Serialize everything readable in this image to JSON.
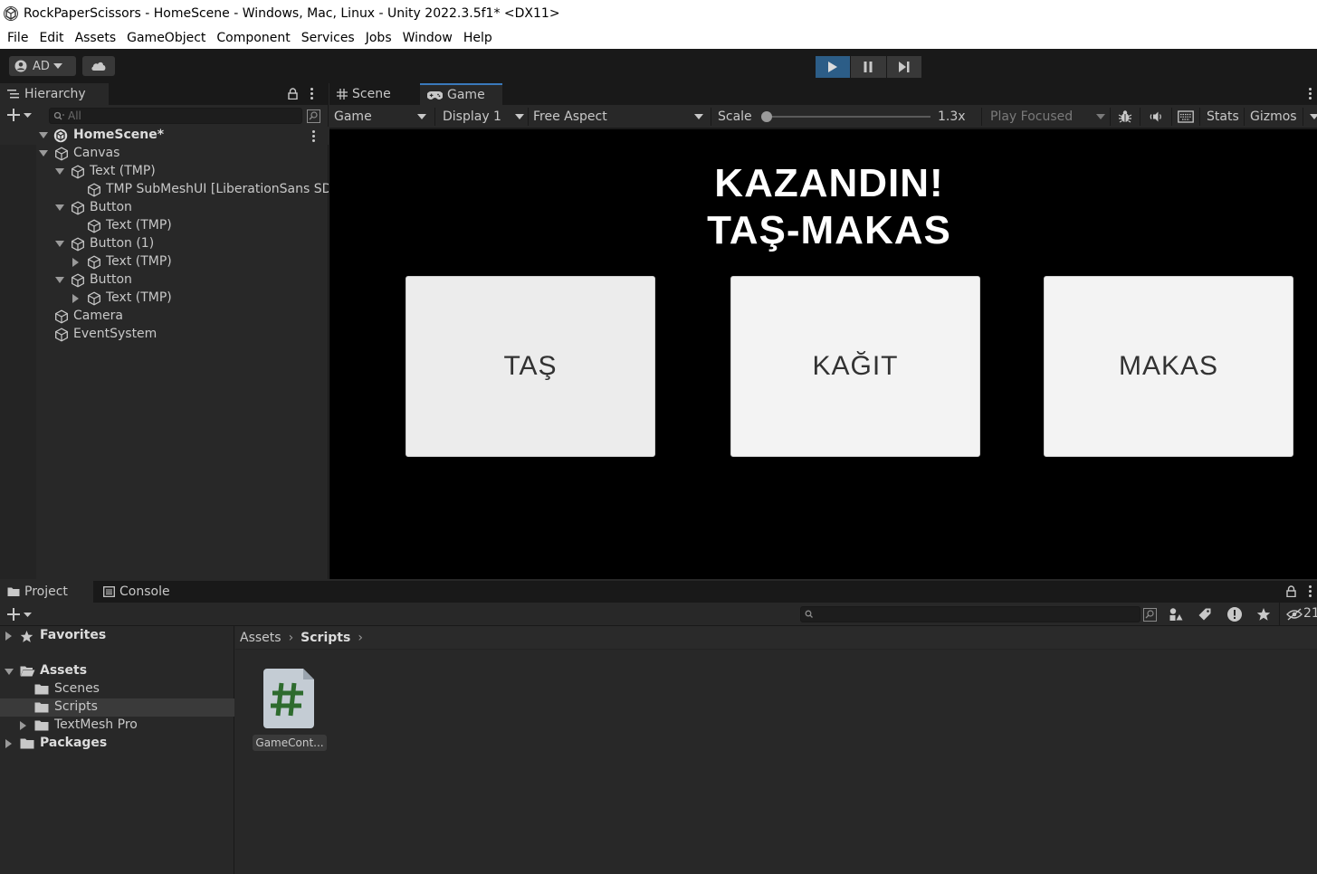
{
  "window": {
    "title": "RockPaperScissors - HomeScene - Windows, Mac, Linux - Unity 2022.3.5f1* <DX11>"
  },
  "menu": [
    "File",
    "Edit",
    "Assets",
    "GameObject",
    "Component",
    "Services",
    "Jobs",
    "Window",
    "Help"
  ],
  "toolbar": {
    "account_label": "AD"
  },
  "hierarchy": {
    "tab_label": "Hierarchy",
    "search_placeholder": "All",
    "scene_name": "HomeScene*",
    "items": [
      {
        "label": "Canvas",
        "depth": 1,
        "expander": "down"
      },
      {
        "label": "Text (TMP)",
        "depth": 2,
        "expander": "down"
      },
      {
        "label": "TMP SubMeshUI [LiberationSans SDF Material + LiberationSans SDF - Fallback Atlas]",
        "depth": 3,
        "expander": "none"
      },
      {
        "label": "Button",
        "depth": 2,
        "expander": "down"
      },
      {
        "label": "Text (TMP)",
        "depth": 3,
        "expander": "none"
      },
      {
        "label": "Button (1)",
        "depth": 2,
        "expander": "down"
      },
      {
        "label": "Text (TMP)",
        "depth": 3,
        "expander": "right"
      },
      {
        "label": "Button",
        "depth": 2,
        "expander": "down"
      },
      {
        "label": "Text (TMP)",
        "depth": 3,
        "expander": "right"
      },
      {
        "label": "Camera",
        "depth": 1,
        "expander": "none"
      },
      {
        "label": "EventSystem",
        "depth": 1,
        "expander": "none"
      }
    ]
  },
  "game_panel": {
    "tabs": [
      "Scene",
      "Game"
    ],
    "active_tab": "Game",
    "view_select": "Game",
    "display_select": "Display 1",
    "aspect_select": "Free Aspect",
    "scale_label": "Scale",
    "scale_value": "1.3x",
    "play_mode": "Play Focused",
    "stats_label": "Stats",
    "gizmos_label": "Gizmos"
  },
  "game": {
    "result_line1": "KAZANDIN!",
    "result_line2": "TAŞ-MAKAS",
    "buttons": [
      "TAŞ",
      "KAĞIT",
      "MAKAS"
    ]
  },
  "project": {
    "tabs": [
      "Project",
      "Console"
    ],
    "hidden_count": "21",
    "breadcrumb": [
      "Assets",
      "Scripts"
    ],
    "tree": [
      {
        "label": "Favorites",
        "bold": true,
        "expander": "right",
        "icon": "star-icon"
      },
      {
        "label": "Assets",
        "bold": true,
        "expander": "down",
        "icon": "folder-open-icon"
      },
      {
        "label": "Scenes",
        "bold": false,
        "expander": "none",
        "icon": "folder-icon"
      },
      {
        "label": "Scripts",
        "bold": false,
        "expander": "none",
        "icon": "folder-icon",
        "selected": true
      },
      {
        "label": "TextMesh Pro",
        "bold": false,
        "expander": "right",
        "icon": "folder-icon"
      },
      {
        "label": "Packages",
        "bold": true,
        "expander": "right",
        "icon": "folder-icon"
      }
    ],
    "assets": [
      {
        "label": "GameCont...",
        "icon": "csharp-script-icon"
      }
    ]
  },
  "colors": {
    "accent": "#3a79bb",
    "play_active": "#2c5d87",
    "script_hash": "#2e6b2e"
  }
}
